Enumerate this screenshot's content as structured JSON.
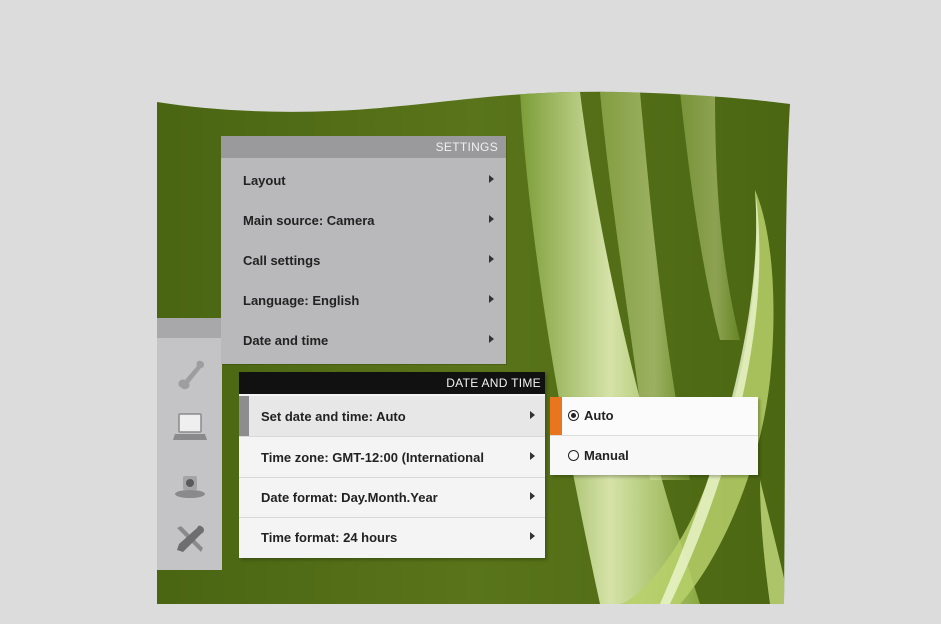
{
  "settings": {
    "title": "SETTINGS",
    "items": [
      {
        "label": "Layout"
      },
      {
        "label": "Main source: Camera"
      },
      {
        "label": "Call settings"
      },
      {
        "label": "Language: English"
      },
      {
        "label": "Date and time"
      }
    ]
  },
  "sidebar": {
    "icons": [
      "phone-icon",
      "laptop-icon",
      "camera-icon",
      "tools-icon"
    ]
  },
  "date_time": {
    "title": "DATE AND TIME",
    "items": [
      {
        "label": "Set date and time: Auto",
        "selected": true
      },
      {
        "label": "Time zone: GMT-12:00 (International"
      },
      {
        "label": "Date format: Day.Month.Year"
      },
      {
        "label": "Time format: 24 hours"
      }
    ]
  },
  "set_date_options": {
    "options": [
      {
        "label": "Auto",
        "checked": true
      },
      {
        "label": "Manual",
        "checked": false
      }
    ],
    "accent_color": "#e8761e"
  },
  "colors": {
    "background": "#dcdcdc",
    "wallpaper_green": "#4e6a14",
    "menu_header_dark": "#111111"
  }
}
